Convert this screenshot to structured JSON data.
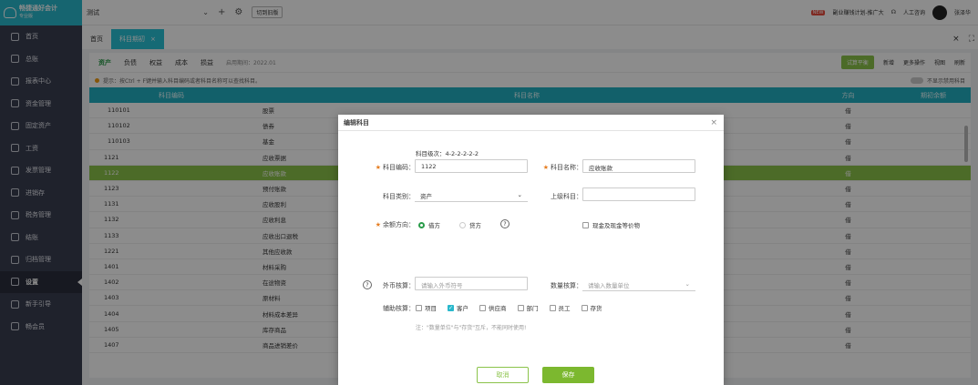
{
  "app": {
    "name": "畅捷通好会计",
    "edition": "专业版"
  },
  "sidebar": {
    "items": [
      {
        "label": "首页",
        "icon": "home-icon"
      },
      {
        "label": "总账",
        "icon": "ledger-icon"
      },
      {
        "label": "报表中心",
        "icon": "chart-icon"
      },
      {
        "label": "资金管理",
        "icon": "wallet-icon"
      },
      {
        "label": "固定资产",
        "icon": "building-icon"
      },
      {
        "label": "工资",
        "icon": "salary-icon"
      },
      {
        "label": "发票管理",
        "icon": "invoice-icon"
      },
      {
        "label": "进销存",
        "icon": "inventory-icon"
      },
      {
        "label": "税务管理",
        "icon": "tax-icon"
      },
      {
        "label": "结账",
        "icon": "closing-icon"
      },
      {
        "label": "归档管理",
        "icon": "archive-icon"
      },
      {
        "label": "设置",
        "icon": "gear-icon"
      },
      {
        "label": "新手引导",
        "icon": "guide-icon"
      },
      {
        "label": "畅会员",
        "icon": "vip-icon"
      }
    ]
  },
  "topbar": {
    "account": "测试",
    "switch_label": "切到旧版",
    "promo": "副业赚钱计划-推广大",
    "service": "人工咨询",
    "user": "张泽华"
  },
  "tabs": {
    "home": "首页",
    "active": "科目期初",
    "close": "×"
  },
  "filters": {
    "items": [
      "资产",
      "负债",
      "权益",
      "成本",
      "损益"
    ],
    "period": "启用期间：2022.01"
  },
  "actions": {
    "trial": "试算平衡",
    "add": "新增",
    "more": "更多操作",
    "view": "视图",
    "refresh": "刷新"
  },
  "tip": {
    "text": "提示：按Ctrl + F键并输入科目编码或者科目名称可以查找科目。",
    "toggle": "不显示禁用科目"
  },
  "table": {
    "headers": [
      "科目编码",
      "科目名称",
      "方向",
      "期初余额"
    ],
    "rows": [
      {
        "code": "110101",
        "name": "股票",
        "dir": "借",
        "level": 2
      },
      {
        "code": "110102",
        "name": "债券",
        "dir": "借",
        "level": 2
      },
      {
        "code": "110103",
        "name": "基金",
        "dir": "借",
        "level": 2
      },
      {
        "code": "1121",
        "name": "应收票据",
        "dir": "借",
        "level": 1
      },
      {
        "code": "1122",
        "name": "应收账款",
        "dir": "借",
        "level": 1
      },
      {
        "code": "1123",
        "name": "预付账款",
        "dir": "借",
        "level": 1
      },
      {
        "code": "1131",
        "name": "应收股利",
        "dir": "借",
        "level": 1
      },
      {
        "code": "1132",
        "name": "应收利息",
        "dir": "借",
        "level": 1
      },
      {
        "code": "1133",
        "name": "应收出口退税",
        "dir": "借",
        "level": 1
      },
      {
        "code": "1221",
        "name": "其他应收款",
        "dir": "借",
        "level": 1
      },
      {
        "code": "1401",
        "name": "材料采购",
        "dir": "借",
        "level": 1
      },
      {
        "code": "1402",
        "name": "在途物资",
        "dir": "借",
        "level": 1
      },
      {
        "code": "1403",
        "name": "原材料",
        "dir": "借",
        "level": 1
      },
      {
        "code": "1404",
        "name": "材料成本差异",
        "dir": "借",
        "level": 1
      },
      {
        "code": "1405",
        "name": "库存商品",
        "dir": "借",
        "level": 1
      },
      {
        "code": "1407",
        "name": "商品进销差价",
        "dir": "借",
        "level": 1
      }
    ],
    "selected_index": 4
  },
  "dialog": {
    "title": "编辑科目",
    "close": "×",
    "level_info": "科目级次：4-2-2-2-2-2",
    "code_label": "科目编码：",
    "code_value": "1122",
    "name_label": "科目名称：",
    "name_value": "应收账款",
    "category_label": "科目类别：",
    "category_value": "资产",
    "parent_label": "上级科目：",
    "parent_value": "",
    "direction_label": "余额方向：",
    "debit": "借方",
    "credit": "贷方",
    "cash_label": "现金及现金等价物",
    "currency_label": "外币核算：",
    "currency_placeholder": "请输入外币符号",
    "qty_label": "数量核算：",
    "qty_placeholder": "请输入数量单位",
    "aux_label": "辅助核算：",
    "aux_items": [
      {
        "label": "项目",
        "checked": false
      },
      {
        "label": "客户",
        "checked": true
      },
      {
        "label": "供应商",
        "checked": false
      },
      {
        "label": "部门",
        "checked": false
      },
      {
        "label": "员工",
        "checked": false
      },
      {
        "label": "存货",
        "checked": false
      }
    ],
    "note": "注：\"数量单位\"与\"存货\"互斥，不能同时使用!",
    "cancel": "取消",
    "save": "保存"
  }
}
